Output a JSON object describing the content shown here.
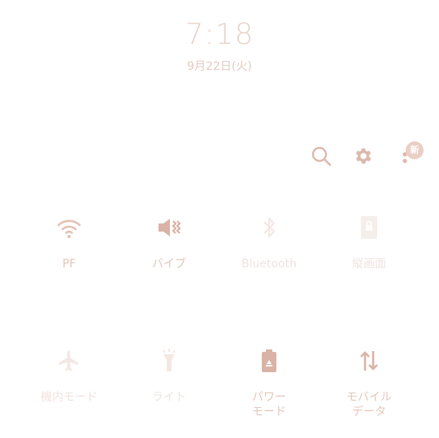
{
  "status": {
    "time": "7:18",
    "date": "9月22日(火)"
  },
  "header": {
    "search_icon": "search-icon",
    "settings_icon": "gear-icon",
    "more_icon": "more-vertical-icon",
    "new_badge": "新"
  },
  "tiles": [
    {
      "label": "PF",
      "icon": "wifi-icon",
      "active": true
    },
    {
      "label": "バイブ",
      "icon": "vibrate-icon",
      "active": true
    },
    {
      "label": "Bluetooth",
      "icon": "bluetooth-icon",
      "active": false
    },
    {
      "label": "縦画面",
      "icon": "portrait-lock-icon",
      "active": false
    },
    {
      "label": "機内モード",
      "icon": "airplane-icon",
      "active": false
    },
    {
      "label": "ライト",
      "icon": "flashlight-icon",
      "active": false
    },
    {
      "label": "パワー\nモード",
      "icon": "battery-recycle-icon",
      "active": true
    },
    {
      "label": "モバイル\nデータ",
      "icon": "mobile-data-icon",
      "active": true
    }
  ],
  "colors": {
    "accent": "#d9b3a5",
    "inactive": "#f3e8e4",
    "text": "#e3c7bb"
  }
}
